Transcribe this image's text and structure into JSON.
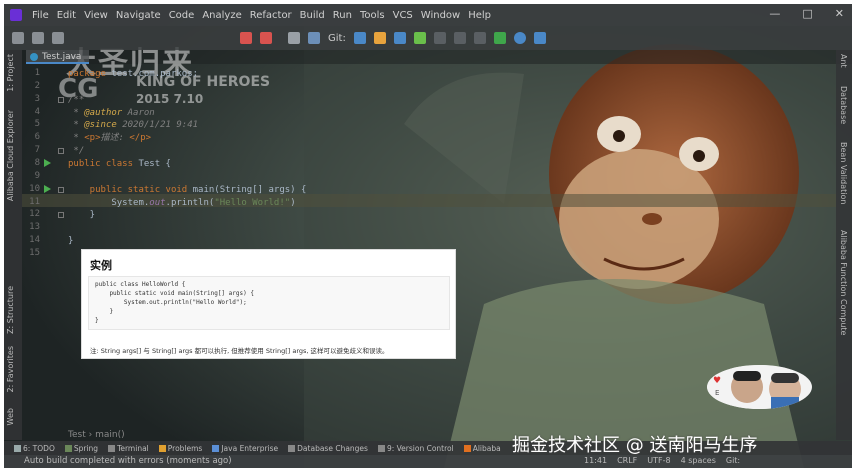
{
  "menubar": {
    "items": [
      "File",
      "Edit",
      "View",
      "Navigate",
      "Code",
      "Analyze",
      "Refactor",
      "Build",
      "Run",
      "Tools",
      "VCS",
      "Window",
      "Help"
    ],
    "window_controls": [
      "—",
      "□",
      "✕"
    ]
  },
  "toolbar": {
    "git_label": "Git:"
  },
  "left_strip": {
    "tabs": [
      "1: Project",
      "Alibaba Cloud Explorer",
      "Z: Structure",
      "2: Favorites",
      "Web"
    ]
  },
  "right_strip": {
    "tabs": [
      "Ant",
      "Database",
      "Bean Validation",
      "Alibaba Function Compute"
    ]
  },
  "editor_tab": {
    "label": "Test.java"
  },
  "poster": {
    "title": "大圣归来",
    "cg": "CG",
    "subtitle": "KING OF HEROES",
    "date": "2015 7.10"
  },
  "code": {
    "lines": [
      {
        "n": "1",
        "parts": [
          {
            "c": "kw",
            "t": "package "
          },
          {
            "c": "pkg",
            "t": "test.com.parkos"
          },
          {
            "c": "txt",
            "t": ";"
          }
        ]
      },
      {
        "n": "2",
        "parts": []
      },
      {
        "n": "3",
        "parts": [
          {
            "c": "cmt",
            "t": "/**"
          }
        ]
      },
      {
        "n": "4",
        "parts": [
          {
            "c": "cmt",
            "t": " * "
          },
          {
            "c": "tag",
            "t": "@author"
          },
          {
            "c": "cmt",
            "t": " Aaron"
          }
        ]
      },
      {
        "n": "5",
        "parts": [
          {
            "c": "cmt",
            "t": " * "
          },
          {
            "c": "tag",
            "t": "@since"
          },
          {
            "c": "cmt",
            "t": " 2020/1/21 9:41"
          }
        ]
      },
      {
        "n": "6",
        "parts": [
          {
            "c": "cmt",
            "t": " * "
          },
          {
            "c": "kw",
            "t": "<p>"
          },
          {
            "c": "cmt",
            "t": "描述: "
          },
          {
            "c": "kw",
            "t": "</p>"
          }
        ]
      },
      {
        "n": "7",
        "parts": [
          {
            "c": "cmt",
            "t": " */"
          }
        ]
      },
      {
        "n": "8",
        "parts": [
          {
            "c": "kw",
            "t": "public class "
          },
          {
            "c": "cls",
            "t": "Test "
          },
          {
            "c": "txt",
            "t": "{"
          }
        ]
      },
      {
        "n": "9",
        "parts": []
      },
      {
        "n": "10",
        "parts": [
          {
            "c": "kw",
            "t": "    public static void "
          },
          {
            "c": "txt",
            "t": "main(String[] "
          },
          {
            "c": "cls",
            "t": "args"
          },
          {
            "c": "txt",
            "t": ") {"
          }
        ]
      },
      {
        "n": "11",
        "parts": [
          {
            "c": "txt",
            "t": "        System."
          },
          {
            "c": "field",
            "t": "out"
          },
          {
            "c": "txt",
            "t": ".println("
          },
          {
            "c": "str",
            "t": "\"Hello World!\""
          },
          {
            "c": "txt",
            "t": ")"
          }
        ]
      },
      {
        "n": "12",
        "parts": [
          {
            "c": "txt",
            "t": "    }"
          }
        ]
      },
      {
        "n": "13",
        "parts": []
      },
      {
        "n": "14",
        "parts": [
          {
            "c": "txt",
            "t": "}"
          }
        ]
      },
      {
        "n": "15",
        "parts": []
      }
    ]
  },
  "example_panel": {
    "title": "实例",
    "code_lines": [
      "public class HelloWorld {",
      "    public static void main(String[] args) {",
      "        System.out.println(\"Hello World\");",
      "    }",
      "}"
    ],
    "note": "注: String args[] 与 String[] args 都可以执行, 但推荐使用 String[] args, 这样可以避免歧义和误读。"
  },
  "breadcrumb": {
    "class": "Test",
    "method": "main()"
  },
  "bottom_tools": [
    {
      "label": "6: TODO",
      "color": "#9aa"
    },
    {
      "label": "Spring",
      "color": "#6a8759"
    },
    {
      "label": "Terminal",
      "color": "#888"
    },
    {
      "label": "Problems",
      "color": "#e0a030"
    },
    {
      "label": "Java Enterprise",
      "color": "#5b8fd6"
    },
    {
      "label": "Database Changes",
      "color": "#888"
    },
    {
      "label": "9: Version Control",
      "color": "#888"
    },
    {
      "label": "Alibaba",
      "color": "#e07020"
    }
  ],
  "status": {
    "message": "Auto build completed with errors (moments ago)",
    "position": "11:41",
    "line_sep": "CRLF",
    "encoding": "UTF-8",
    "indent": "4 spaces",
    "vcs": "Git:"
  },
  "watermark": "掘金技术社区 @ 送南阳马生序",
  "colors": {
    "accent": "#4a88c7",
    "run": "#4caf50"
  }
}
